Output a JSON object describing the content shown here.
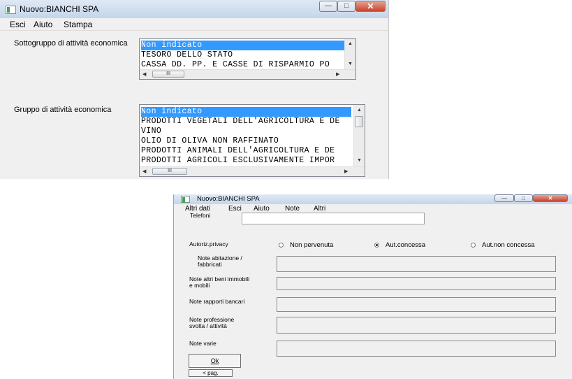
{
  "window1": {
    "title": "Nuovo:BIANCHI SPA",
    "caption_buttons": {
      "minimize": "—",
      "maximize": "□",
      "close": "✕"
    },
    "menu": [
      "Esci",
      "Aiuto",
      "Stampa"
    ],
    "sottogruppo": {
      "label": "Sottogruppo di attività economica",
      "items": [
        "Non indicato",
        "TESORO DELLO STATO",
        "CASSA DD. PP. E CASSE DI RISPARMIO PO"
      ],
      "selected_index": 0
    },
    "gruppo": {
      "label": "Gruppo di attività economica",
      "items": [
        "Non indicato",
        "PRODOTTI VEGETALI DELL'AGRICOLTURA E DE",
        "VINO",
        "OLIO DI OLIVA NON RAFFINATO",
        "PRODOTTI ANIMALI DELL'AGRICOLTURA E DE",
        "PRODOTTI AGRICOLI ESCLUSIVAMENTE IMPOR"
      ],
      "selected_index": 0
    },
    "scroll_thumb_glyph": "III",
    "arrow_up": "▲",
    "arrow_down": "▼",
    "arrow_left": "◀",
    "arrow_right": "▶"
  },
  "window2": {
    "title": "Nuovo:BIANCHI SPA",
    "caption_buttons": {
      "minimize": "—",
      "maximize": "□",
      "close": "✕"
    },
    "menu": [
      "Altri dati",
      "Esci",
      "Aiuto",
      "Note",
      "Altri"
    ],
    "telefoni_label": "Telefoni",
    "telefoni_value": "",
    "privacy": {
      "label": "Autoriz.privacy",
      "options": [
        "Non pervenuta",
        "Aut.concessa",
        "Aut.non concessa"
      ],
      "selected_index": 1
    },
    "note_abitazione_label": [
      "Note abitazione /",
      "fabbricati"
    ],
    "note_beni_label": [
      "Note altri beni immobili",
      "e mobili"
    ],
    "note_rapporti_label": "Note rapporti bancari",
    "note_professione_label": [
      "Note professione",
      "svolta / attività"
    ],
    "note_varie_label": "Note varie",
    "ok_label": "Ok",
    "prev_label": "< pag."
  }
}
